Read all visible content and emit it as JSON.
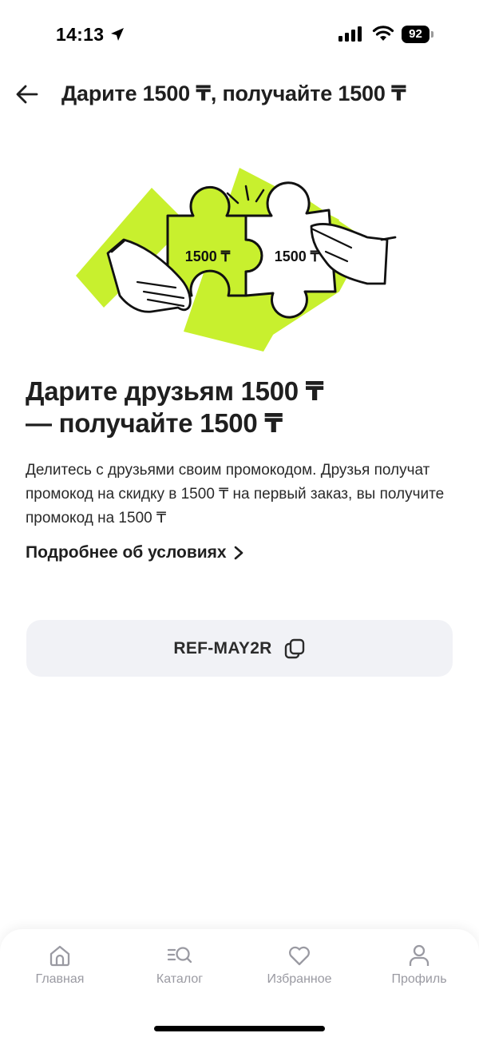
{
  "status_bar": {
    "time": "14:13",
    "battery": "92",
    "icons": [
      "location-arrow-icon",
      "signal-icon",
      "wifi-icon",
      "battery-icon"
    ]
  },
  "header": {
    "title": "Дарите 1500 ₸, получайте 1500 ₸",
    "back_icon": "arrow-left-icon"
  },
  "illustration": {
    "left_piece_label": "1500 ₸",
    "right_piece_label": "1500 ₸",
    "accent_color": "#c8f02e"
  },
  "promo": {
    "heading_line1": "Дарите друзьям 1500 ₸",
    "heading_line2": "— получайте 1500 ₸",
    "description": "Делитесь с друзьями своим промокодом. Друзья получат промокод на скидку в 1500 ₸ на первый заказ, вы получите промокод на 1500 ₸",
    "conditions_link": "Подробнее об условиях",
    "code": "REF-MAY2R",
    "copy_icon": "copy-icon"
  },
  "tab_bar": {
    "tabs": [
      {
        "label": "Главная",
        "icon": "home-icon"
      },
      {
        "label": "Каталог",
        "icon": "catalog-search-icon"
      },
      {
        "label": "Избранное",
        "icon": "heart-icon"
      },
      {
        "label": "Профиль",
        "icon": "profile-icon"
      }
    ]
  },
  "colors": {
    "text_primary": "#1f1f1f",
    "tab_inactive": "#9a9aa2",
    "code_background": "#f1f2f6",
    "accent_green": "#c8f02e"
  }
}
